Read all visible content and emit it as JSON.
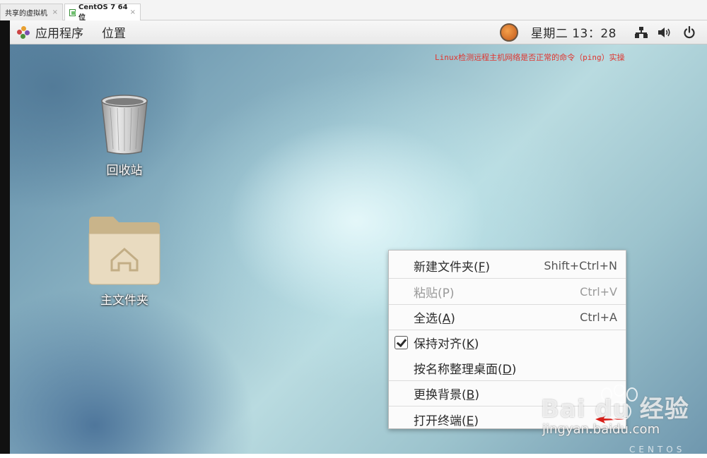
{
  "tabs": [
    {
      "label": "共享的虚拟机",
      "close": "×"
    },
    {
      "label": "CentOS 7 64 位",
      "close": "×"
    }
  ],
  "topbar": {
    "applications": "应用程序",
    "places": "位置",
    "clock": "星期二 13：28",
    "icons": [
      "software-update-icon",
      "network-icon",
      "volume-icon",
      "power-icon"
    ]
  },
  "desktop": {
    "note": "Linux检测远程主机网络是否正常的命令（ping）实操",
    "icons": [
      {
        "label": "回收站",
        "icon": "trash-icon"
      },
      {
        "label": "主文件夹",
        "icon": "home-folder-icon"
      }
    ]
  },
  "context_menu": {
    "items": [
      {
        "label": "新建文件夹(",
        "mnemonic": "F",
        "suffix": ")",
        "shortcut": "Shift+Ctrl+N"
      },
      {
        "label": "粘贴(P)",
        "shortcut": "Ctrl+V"
      },
      {
        "label": "全选(",
        "mnemonic": "A",
        "suffix": ")",
        "shortcut": "Ctrl+A"
      },
      {
        "label": "保持对齐(",
        "mnemonic": "K",
        "suffix": ")",
        "checked": true
      },
      {
        "label": "按名称整理桌面(",
        "mnemonic": "D",
        "suffix": ")"
      },
      {
        "label": "更换背景(",
        "mnemonic": "B",
        "suffix": ")"
      },
      {
        "label": "打开终端(",
        "mnemonic": "E",
        "suffix": ")"
      }
    ]
  },
  "watermark": {
    "brand": "Bai du 经验",
    "url": "jingyan.baidu.com",
    "os": "CENTOS"
  },
  "colors": {
    "note_red": "#e0352f",
    "menu_bg": "#fbfbfb"
  }
}
